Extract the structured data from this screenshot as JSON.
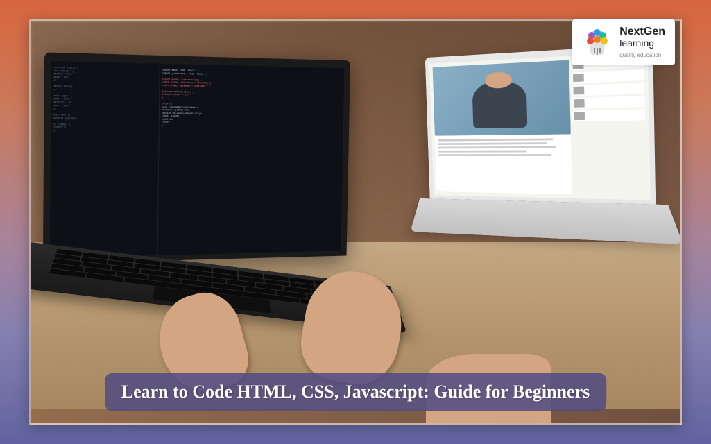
{
  "logo": {
    "name": "NextGen",
    "subtitle": "learning",
    "tagline": "quality education"
  },
  "banner": {
    "title": "Learn to Code HTML, CSS, Javascript: Guide for Beginners"
  }
}
